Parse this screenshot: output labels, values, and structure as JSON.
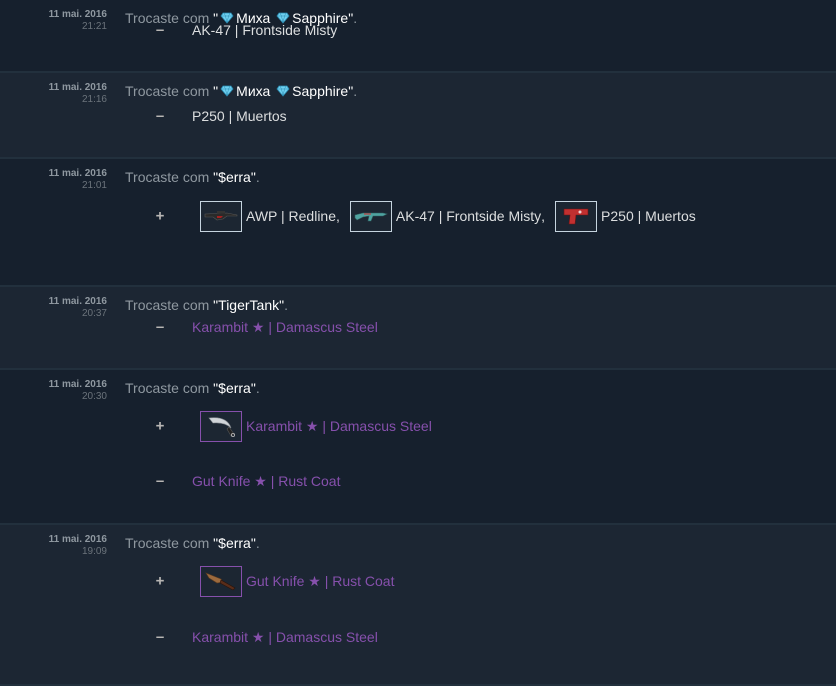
{
  "trades": [
    {
      "date": "11 mai. 2016",
      "time": "21:21",
      "prefix": "Trocaste com",
      "partner": "Миха",
      "partner_suffix": "Sapphire",
      "has_gems": true,
      "lines": [
        {
          "sign": "–",
          "items": [
            {
              "name": "AK-47 | Frontside Misty",
              "rarity": "normal"
            }
          ]
        }
      ]
    },
    {
      "date": "11 mai. 2016",
      "time": "21:16",
      "prefix": "Trocaste com",
      "partner": "Миха",
      "partner_suffix": "Sapphire",
      "has_gems": true,
      "lines": [
        {
          "sign": "–",
          "items": [
            {
              "name": "P250 | Muertos",
              "rarity": "normal"
            }
          ]
        }
      ]
    },
    {
      "date": "11 mai. 2016",
      "time": "21:01",
      "prefix": "Trocaste com",
      "partner": "$erra",
      "lines": [
        {
          "sign": "+",
          "items": [
            {
              "name": "AWP | Redline",
              "rarity": "normal",
              "icon": "awp-icon"
            },
            {
              "name": "AK-47 | Frontside Misty",
              "rarity": "normal",
              "icon": "ak47-icon"
            },
            {
              "name": "P250 | Muertos",
              "rarity": "normal",
              "icon": "p250-icon"
            }
          ]
        }
      ]
    },
    {
      "date": "11 mai. 2016",
      "time": "20:37",
      "prefix": "Trocaste com",
      "partner": "TigerTank",
      "lines": [
        {
          "sign": "–",
          "items": [
            {
              "name": "Karambit ★ | Damascus Steel",
              "rarity": "rare"
            }
          ]
        }
      ]
    },
    {
      "date": "11 mai. 2016",
      "time": "20:30",
      "prefix": "Trocaste com",
      "partner": "$erra",
      "lines": [
        {
          "sign": "+",
          "items": [
            {
              "name": "Karambit ★ | Damascus Steel",
              "rarity": "rare",
              "icon": "karambit-icon"
            }
          ]
        },
        {
          "sign": "–",
          "items": [
            {
              "name": "Gut Knife ★ | Rust Coat",
              "rarity": "rare"
            }
          ]
        }
      ]
    },
    {
      "date": "11 mai. 2016",
      "time": "19:09",
      "prefix": "Trocaste com",
      "partner": "$erra",
      "lines": [
        {
          "sign": "+",
          "items": [
            {
              "name": "Gut Knife ★ | Rust Coat",
              "rarity": "rare",
              "icon": "gut-knife-icon"
            }
          ]
        },
        {
          "sign": "–",
          "items": [
            {
              "name": "Karambit ★ | Damascus Steel",
              "rarity": "rare"
            }
          ]
        }
      ]
    }
  ],
  "colors": {
    "background": "#1b2838",
    "rare": "#8650ac",
    "text": "#c6d4df",
    "muted": "#8f98a0"
  }
}
